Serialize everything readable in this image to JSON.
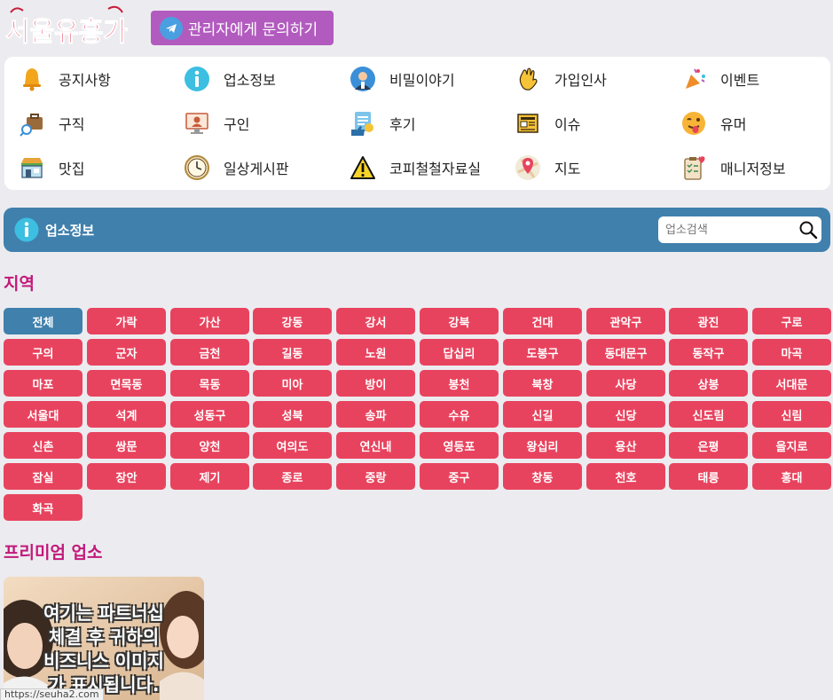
{
  "header": {
    "logo_text": "서울유흥가",
    "contact_label": "관리자에게 문의하기"
  },
  "menu": {
    "items": [
      {
        "label": "공지사항",
        "icon": "bell-icon"
      },
      {
        "label": "업소정보",
        "icon": "info-icon"
      },
      {
        "label": "비밀이야기",
        "icon": "secret-agent-icon"
      },
      {
        "label": "가입인사",
        "icon": "waving-hand-icon"
      },
      {
        "label": "이벤트",
        "icon": "party-popper-icon"
      },
      {
        "label": "구직",
        "icon": "job-search-icon"
      },
      {
        "label": "구인",
        "icon": "recruit-monitor-icon"
      },
      {
        "label": "후기",
        "icon": "review-thumbs-icon"
      },
      {
        "label": "이슈",
        "icon": "newspaper-icon"
      },
      {
        "label": "유머",
        "icon": "tongue-face-icon"
      },
      {
        "label": "맛집",
        "icon": "store-icon"
      },
      {
        "label": "일상게시판",
        "icon": "clock-icon"
      },
      {
        "label": "코피철철자료실",
        "icon": "warning-icon"
      },
      {
        "label": "지도",
        "icon": "map-pin-icon"
      },
      {
        "label": "매니저정보",
        "icon": "clipboard-heart-icon"
      }
    ]
  },
  "section": {
    "title": "업소정보",
    "search_placeholder": "업소검색"
  },
  "region": {
    "title": "지역",
    "items": [
      "전체",
      "가락",
      "가산",
      "강동",
      "강서",
      "강북",
      "건대",
      "관악구",
      "광진",
      "구로",
      "구의",
      "군자",
      "금천",
      "길동",
      "노원",
      "답십리",
      "도봉구",
      "동대문구",
      "동작구",
      "마곡",
      "마포",
      "면목동",
      "목동",
      "미아",
      "방이",
      "봉천",
      "북창",
      "사당",
      "상봉",
      "서대문",
      "서울대",
      "석계",
      "성동구",
      "성북",
      "송파",
      "수유",
      "신길",
      "신당",
      "신도림",
      "신림",
      "신촌",
      "쌍문",
      "양천",
      "여의도",
      "연신내",
      "영등포",
      "왕십리",
      "용산",
      "은평",
      "을지로",
      "잠실",
      "장안",
      "제기",
      "종로",
      "중랑",
      "중구",
      "창동",
      "천호",
      "태릉",
      "홍대",
      "화곡"
    ],
    "active_index": 0
  },
  "premium": {
    "title": "프리미엄 업소",
    "ad_lines": [
      "여기는 파트너십",
      "체결 후 귀하의",
      "비즈니스 이미지",
      "가 표시됩니다."
    ]
  },
  "status_url": "https://seuha2.com",
  "colors": {
    "region_button": "#e8435e",
    "region_active": "#4080ad",
    "section_bar": "#4080ad",
    "heading": "#c2187a",
    "contact_button": "#b25bbf"
  }
}
